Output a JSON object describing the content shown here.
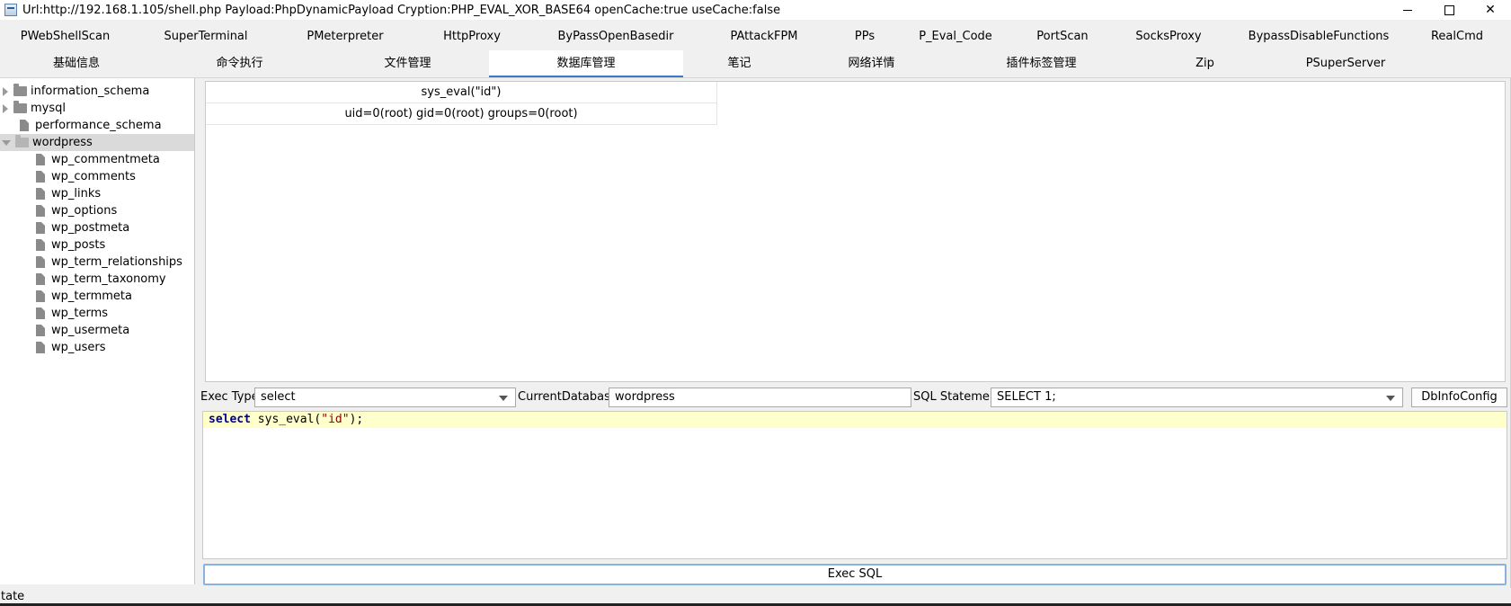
{
  "window": {
    "title": "Url:http://192.168.1.105/shell.php Payload:PhpDynamicPayload Cryption:PHP_EVAL_XOR_BASE64 openCache:true useCache:false",
    "minimize_glyph": "",
    "close_glyph": "✕"
  },
  "plugin_tabs": [
    "PWebShellScan",
    "SuperTerminal",
    "PMeterpreter",
    "HttpProxy",
    "ByPassOpenBasedir",
    "PAttackFPM",
    "PPs",
    "P_Eval_Code",
    "PortScan",
    "SocksProxy",
    "BypassDisableFunctions",
    "RealCmd"
  ],
  "main_tabs": [
    "基础信息",
    "命令执行",
    "文件管理",
    "数据库管理",
    "笔记",
    "网络详情",
    "插件标签管理",
    "Zip",
    "PSuperServer"
  ],
  "active_main_tab": 3,
  "tree": {
    "databases": [
      {
        "name": "information_schema",
        "type": "folder",
        "expanded": false
      },
      {
        "name": "mysql",
        "type": "folder",
        "expanded": false
      },
      {
        "name": "performance_schema",
        "type": "file"
      },
      {
        "name": "wordpress",
        "type": "folder",
        "expanded": true,
        "selected": true
      }
    ],
    "wordpress_tables": [
      "wp_commentmeta",
      "wp_comments",
      "wp_links",
      "wp_options",
      "wp_postmeta",
      "wp_posts",
      "wp_term_relationships",
      "wp_term_taxonomy",
      "wp_termmeta",
      "wp_terms",
      "wp_usermeta",
      "wp_users"
    ]
  },
  "results": {
    "header": "sys_eval(\"id\")",
    "row": "uid=0(root) gid=0(root) groups=0(root)"
  },
  "controls": {
    "exec_type_label": "Exec Type",
    "exec_type_value": "select",
    "current_db_label": "CurrentDatabase",
    "current_db_value": "wordpress",
    "sql_statement_label": "SQL Statement",
    "sql_statement_value": "SELECT 1;",
    "dbinfo_button": "DbInfoConfig"
  },
  "editor": {
    "keyword": "select",
    "func": " sys_eval(",
    "string": "\"id\"",
    "tail": ");"
  },
  "exec_button": "Exec SQL",
  "status": "tate"
}
